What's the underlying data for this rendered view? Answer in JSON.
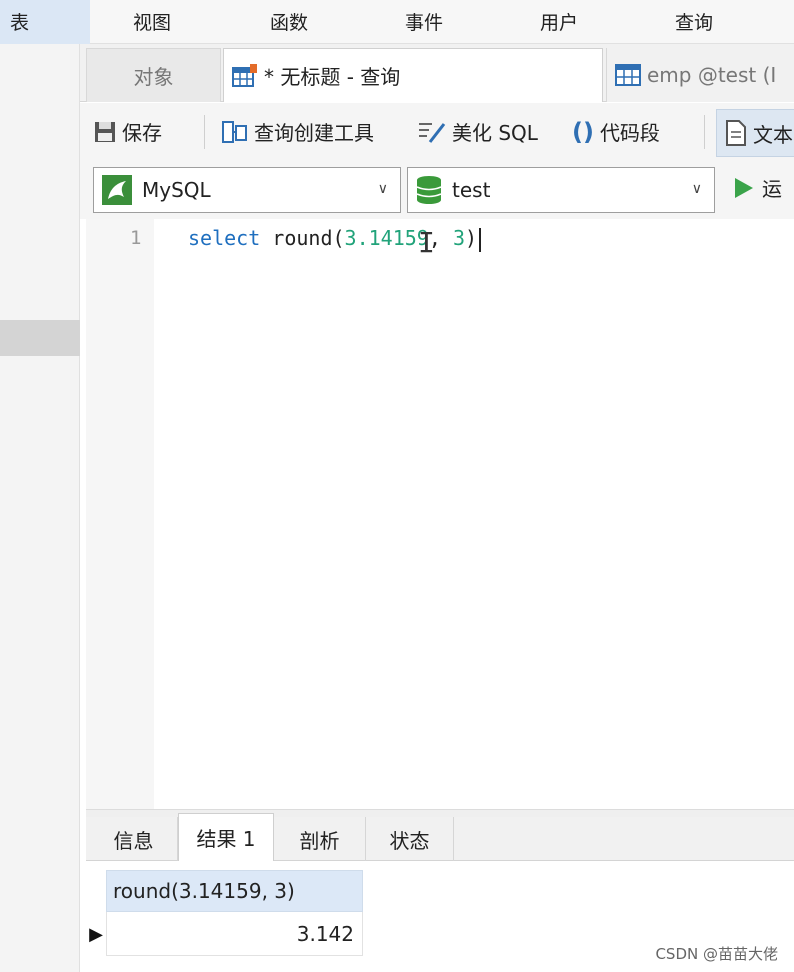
{
  "menu": {
    "items": [
      "表",
      "视图",
      "函数",
      "事件",
      "用户",
      "查询"
    ]
  },
  "tabs": {
    "objects": "对象",
    "current": "* 无标题 - 查询",
    "emp": "emp @test (I"
  },
  "toolbar": {
    "save": "保存",
    "query_builder": "查询创建工具",
    "beautify": "美化 SQL",
    "code_snippet": "代码段",
    "text": "文本"
  },
  "selectors": {
    "connection": "MySQL",
    "database": "test",
    "run": "运"
  },
  "editor": {
    "line_number": "1",
    "code_keyword": "select",
    "code_func": " round(",
    "code_arg1": "3.14159",
    "code_sep": ", ",
    "code_arg2": "3",
    "code_close": ")"
  },
  "results": {
    "tabs": [
      "信息",
      "结果 1",
      "剖析",
      "状态"
    ],
    "active_tab": "结果 1",
    "column": "round(3.14159, 3)",
    "value": "3.142"
  },
  "watermark": "CSDN @苗苗大佬",
  "colors": {
    "keyword": "#1f6fbf",
    "number": "#21a37a",
    "header_bg": "#dce8f7",
    "run_green": "#3aa34a"
  }
}
